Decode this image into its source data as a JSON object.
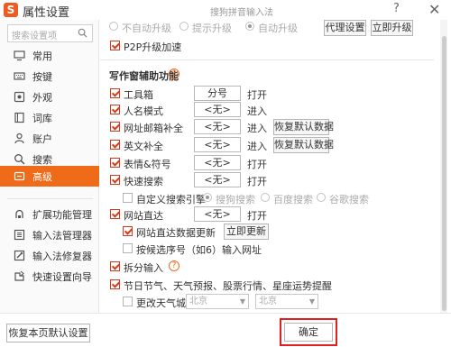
{
  "window": {
    "title": "属性设置",
    "watermark": "搜狗拼音输入法",
    "help": "?",
    "close": "✕"
  },
  "sidebar": {
    "search_placeholder": "搜索设置项",
    "items": [
      {
        "label": "常用",
        "icon": "monitor-icon"
      },
      {
        "label": "按键",
        "icon": "keyboard-icon"
      },
      {
        "label": "外观",
        "icon": "eye-icon"
      },
      {
        "label": "词库",
        "icon": "book-icon"
      },
      {
        "label": "账户",
        "icon": "user-icon"
      },
      {
        "label": "搜索",
        "icon": "search-icon"
      },
      {
        "label": "高级",
        "icon": "advanced-icon",
        "active": true
      }
    ],
    "tools": [
      {
        "label": "扩展功能管理",
        "icon": "extension-icon"
      },
      {
        "label": "输入法管理器",
        "icon": "manager-icon"
      },
      {
        "label": "输入法修复器",
        "icon": "repair-icon"
      },
      {
        "label": "快速设置向导",
        "icon": "wizard-icon"
      }
    ]
  },
  "upgrade": {
    "options": [
      "不自动升级",
      "提示升级",
      "自动升级"
    ],
    "selected": "自动升级",
    "proxy_button": "代理设置",
    "upgrade_button": "立即升级",
    "p2p_label": "P2P升级加速"
  },
  "writing": {
    "section_title": "写作窗辅助功能",
    "help": "?",
    "rows": [
      {
        "label": "工具箱",
        "value": "分号",
        "action": "打开"
      },
      {
        "label": "人名模式",
        "value": "<无>",
        "action": "进入"
      },
      {
        "label": "网址邮箱补全",
        "value": "<无>",
        "action": "进入",
        "button": "恢复默认数据"
      },
      {
        "label": "英文补全",
        "value": "<无>",
        "action": "进入",
        "button": "恢复默认数据"
      },
      {
        "label": "表情&符号",
        "value": "<无>",
        "action": "打开"
      },
      {
        "label": "快速搜索",
        "value": "<无>",
        "action": "打开"
      }
    ],
    "custom_engine_label": "自定义搜索引擎",
    "engines": [
      "搜狗搜索",
      "百度搜索",
      "谷歌搜索"
    ],
    "engine_selected": "搜狗搜索",
    "site_direct": {
      "label": "网站直达",
      "value": "<无>",
      "action": "打开"
    },
    "site_update_label": "网站直达数据更新",
    "site_update_button": "立即更新",
    "candidate_label": "按候选序号（如6）输入网址",
    "split_label": "拆分输入",
    "split_help": "?",
    "holiday_label": "节日节气、天气预报、股票行情、星座运势提醒",
    "weather_city_label": "更改天气城市",
    "city_province": "北京",
    "city_name": "北京"
  },
  "footer": {
    "reset_label": "恢复本页默认设置",
    "ok_label": "确定"
  },
  "colors": {
    "accent": "#ef6b1a",
    "highlight_border": "#e02020"
  }
}
